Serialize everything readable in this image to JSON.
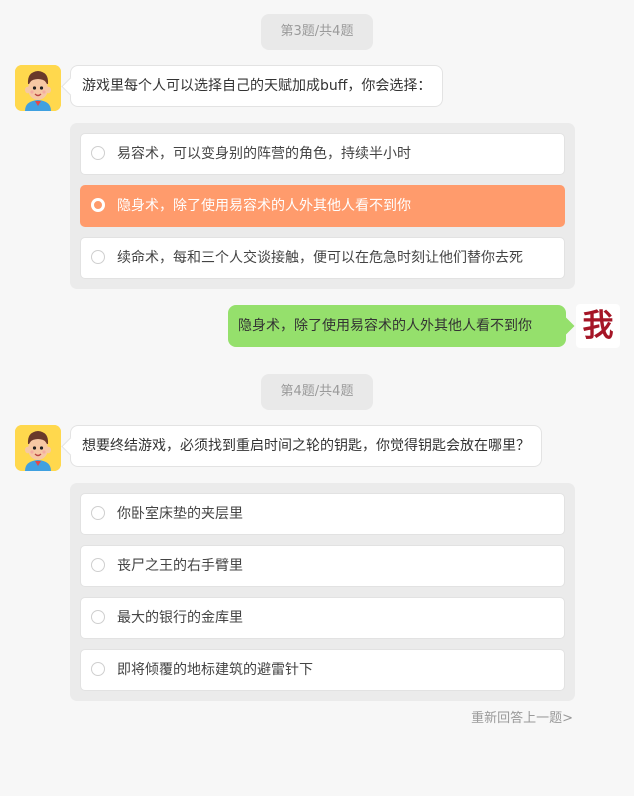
{
  "q3": {
    "progress": "第3题/共4题",
    "question": "游戏里每个人可以选择自己的天赋加成buff，你会选择：",
    "options": [
      {
        "label": "易容术，可以变身别的阵营的角色，持续半小时",
        "selected": false
      },
      {
        "label": "隐身术，除了使用易容术的人外其他人看不到你",
        "selected": true
      },
      {
        "label": "续命术，每和三个人交谈接触，便可以在危急时刻让他们替你去死",
        "selected": false
      }
    ],
    "answer": "隐身术，除了使用易容术的人外其他人看不到你"
  },
  "me_avatar_text": "我",
  "q4": {
    "progress": "第4题/共4题",
    "question": "想要终结游戏，必须找到重启时间之轮的钥匙，你觉得钥匙会放在哪里？",
    "options": [
      {
        "label": "你卧室床垫的夹层里",
        "selected": false
      },
      {
        "label": "丧尸之王的右手臂里",
        "selected": false
      },
      {
        "label": "最大的银行的金库里",
        "selected": false
      },
      {
        "label": "即将倾覆的地标建筑的避雷针下",
        "selected": false
      }
    ]
  },
  "restart_label": "重新回答上一题>",
  "colors": {
    "selected_option": "#ff9b6c",
    "answer_bubble": "#95e06c",
    "avatar_bg": "#ffd84d"
  }
}
